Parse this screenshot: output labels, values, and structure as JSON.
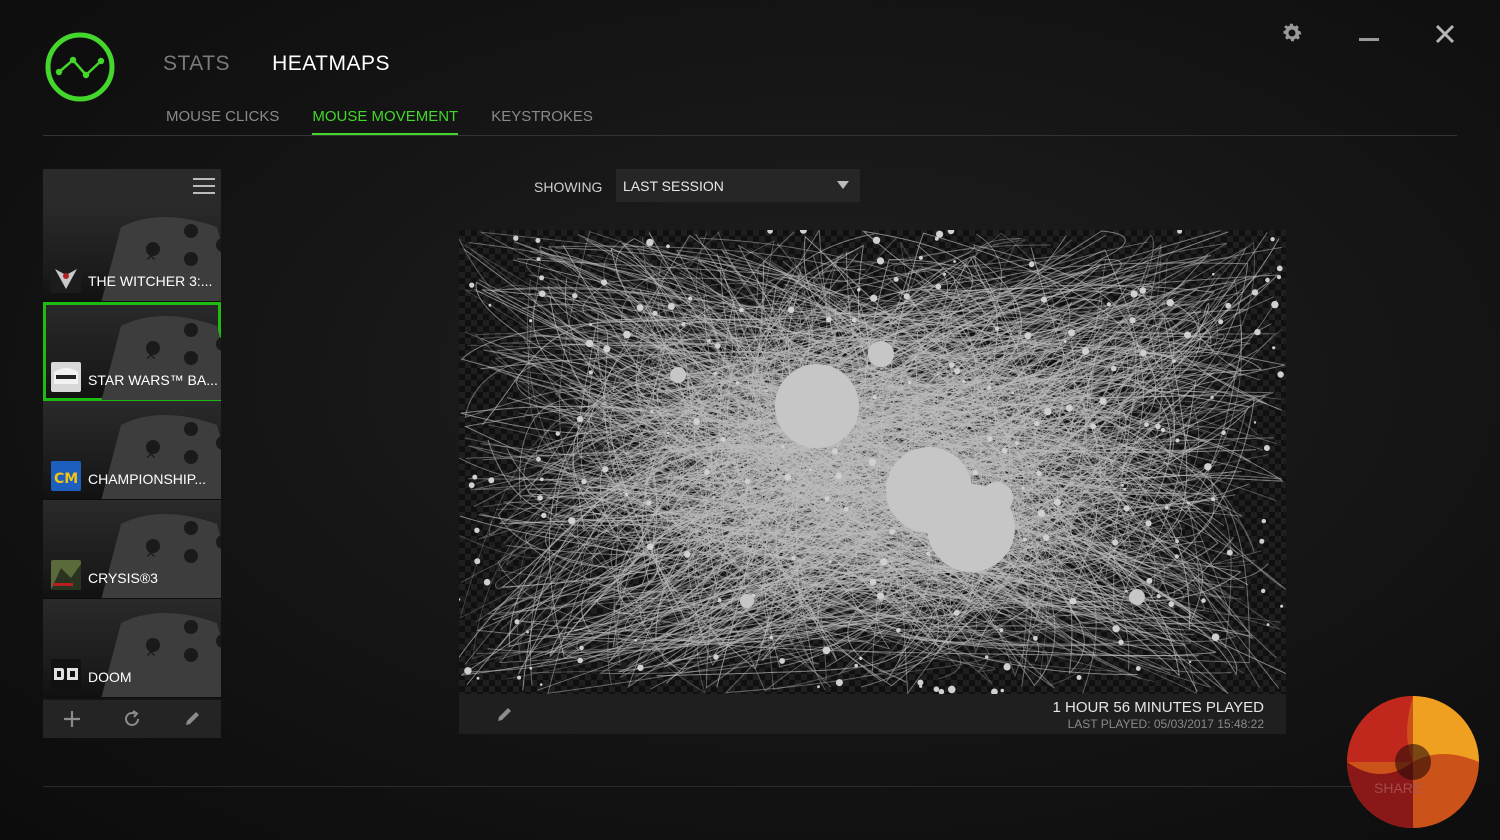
{
  "app": {
    "logo_icon": "razer-stats-logo",
    "accent_color": "#44d62c"
  },
  "nav": {
    "tabs": [
      {
        "label": "STATS",
        "active": false
      },
      {
        "label": "HEATMAPS",
        "active": true
      }
    ]
  },
  "subnav": {
    "tabs": [
      {
        "label": "MOUSE CLICKS",
        "active": false
      },
      {
        "label": "MOUSE MOVEMENT",
        "active": true
      },
      {
        "label": "KEYSTROKES",
        "active": false
      }
    ]
  },
  "window_controls": {
    "settings_icon": "gear-icon",
    "minimize_icon": "minimize-icon",
    "close_icon": "close-icon"
  },
  "sidebar": {
    "menu_icon": "hamburger-icon",
    "games": [
      {
        "name": "THE WITCHER 3:...",
        "icon": "witcher-icon",
        "selected": false
      },
      {
        "name": "STAR WARS™ BA...",
        "icon": "star-wars-icon",
        "selected": true
      },
      {
        "name": "CHAMPIONSHIP...",
        "icon": "cm-icon",
        "selected": false
      },
      {
        "name": "CRYSIS®3",
        "icon": "crysis-icon",
        "selected": false
      },
      {
        "name": "DOOM",
        "icon": "doom-icon",
        "selected": false
      }
    ],
    "footer_icons": [
      "add-icon",
      "refresh-icon",
      "edit-icon"
    ]
  },
  "filter": {
    "label": "SHOWING",
    "value": "LAST SESSION"
  },
  "heatmap": {
    "played": "1 HOUR 56 MINUTES PLAYED",
    "last_played": "LAST PLAYED: 05/03/2017 15:48:22",
    "edit_icon": "pencil-icon"
  },
  "watermark": {
    "share_label": "SHARE"
  }
}
